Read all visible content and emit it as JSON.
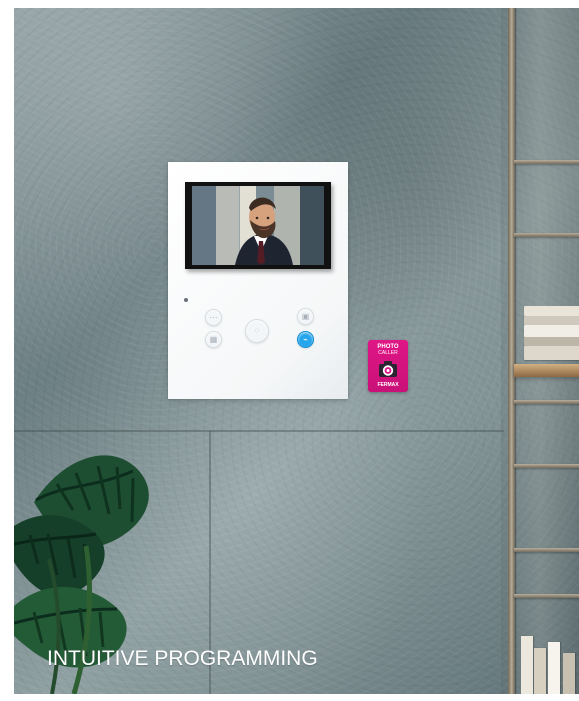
{
  "headline": {
    "text": "INTUITIVE PROGRAMMING"
  },
  "monitor": {
    "screen_content": "caller-video-feed",
    "buttons": [
      {
        "icon": "menu-icon",
        "label": ""
      },
      {
        "icon": "settings-icon",
        "label": ""
      },
      {
        "icon": "call-icon",
        "label": ""
      },
      {
        "icon": "camera-icon",
        "label": ""
      },
      {
        "icon": "door-open-icon",
        "label": ""
      }
    ]
  },
  "badge": {
    "line1": "PHOTO",
    "line2": "CALLER",
    "brand": "FERMAX",
    "icon": "camera-icon",
    "color": "#d4127e"
  },
  "colors": {
    "accent": "#25a5eb",
    "headline": "#ffffff"
  }
}
